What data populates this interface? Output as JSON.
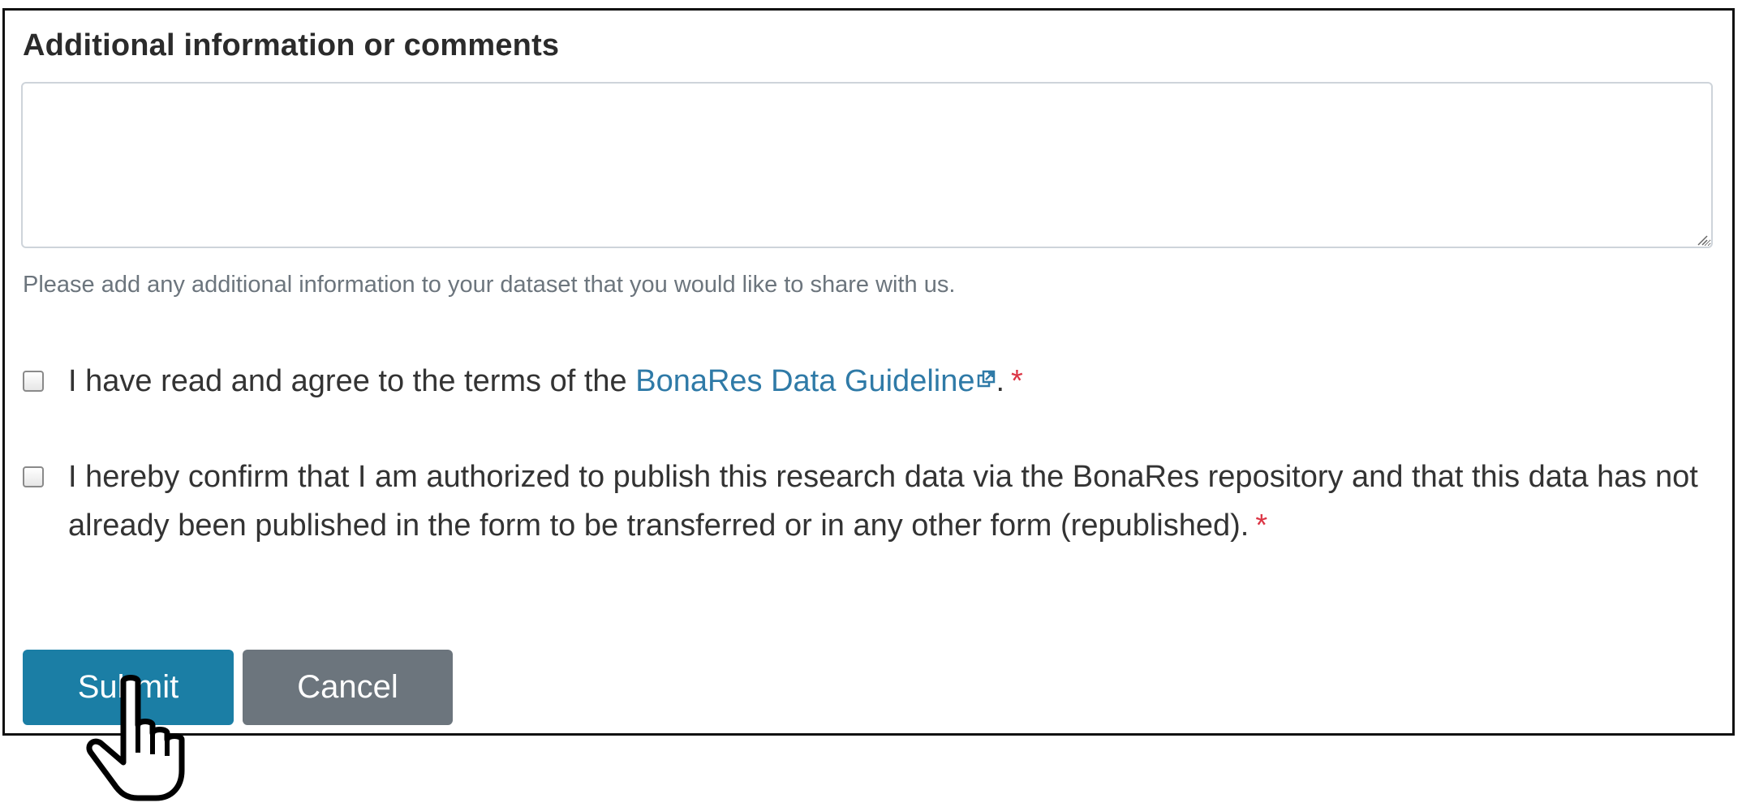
{
  "form": {
    "section_title": "Additional information or comments",
    "comments_value": "",
    "help_text": "Please add any additional information to your dataset that you would like to share with us.",
    "agree": {
      "text_before": "I have read and agree to the terms of the ",
      "link_text": "BonaRes Data Guideline",
      "text_after": ".",
      "required_mark": "*",
      "checked": false
    },
    "confirm": {
      "text": "I hereby confirm that I am authorized to publish this research data via the BonaRes repository and that this data has not already been published in the form to be transferred or in any other form (republished).",
      "required_mark": "*",
      "checked": false
    },
    "buttons": {
      "submit_label": "Submit",
      "cancel_label": "Cancel"
    }
  },
  "icons": {
    "external_link": "external-link-icon",
    "pointer": "hand-pointer-icon",
    "resize": "resize-grip-icon"
  },
  "colors": {
    "submit_bg": "#1b7ea5",
    "cancel_bg": "#6c757d",
    "link": "#2f7aa7",
    "required": "#dc3545",
    "help_text": "#6c757d"
  }
}
